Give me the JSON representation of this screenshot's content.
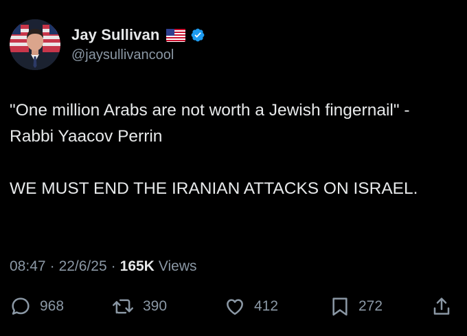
{
  "author": {
    "display_name": "Jay Sullivan",
    "handle": "@jaysullivancool",
    "flag_icon": "us-flag-icon",
    "verified": true,
    "verified_color": "#1d9bf0"
  },
  "tweet": {
    "lines": [
      "\"One million Arabs are not worth a Jewish fingernail\" - Rabbi Yaacov Perrin",
      "WE MUST END THE IRANIAN ATTACKS ON ISRAEL."
    ],
    "time": "08:47",
    "date": "22/6/25",
    "views_count": "165K",
    "views_label": "Views",
    "separator": "·"
  },
  "actions": {
    "replies": "968",
    "reposts": "390",
    "likes": "412",
    "bookmarks": "272"
  },
  "colors": {
    "background": "#000000",
    "primary_text": "#e7e9ea",
    "secondary_text": "#8b98a5",
    "accent": "#1d9bf0"
  }
}
